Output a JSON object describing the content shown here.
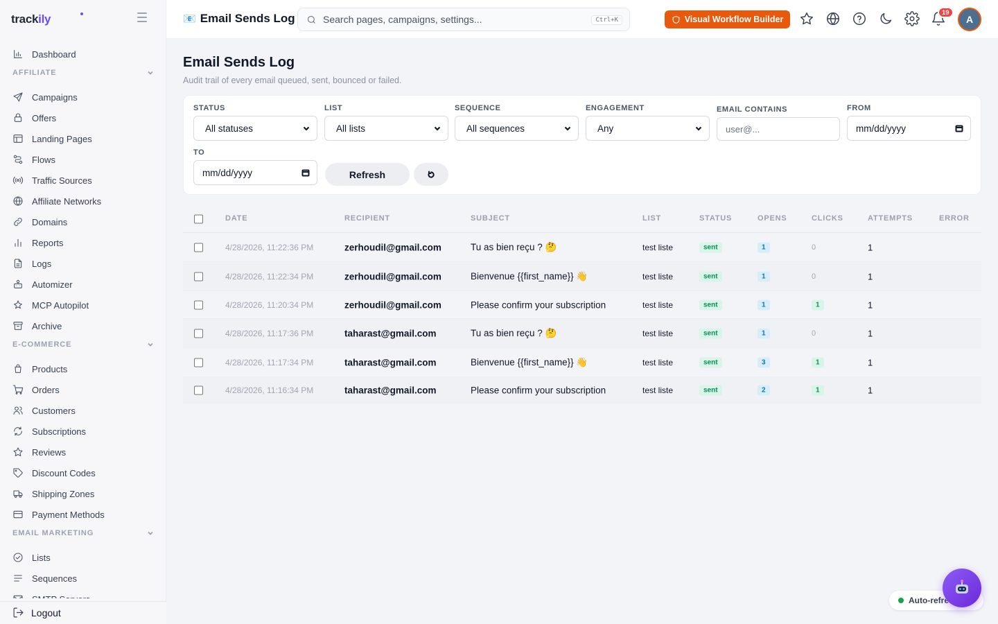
{
  "brand": {
    "name": "track",
    "accent": "ily"
  },
  "sidebar": {
    "items_top": [
      {
        "label": "Dashboard",
        "icon": "bar-chart-icon"
      }
    ],
    "sections": [
      {
        "title": "AFFILIATE",
        "items": [
          {
            "label": "Campaigns",
            "icon": "send-icon"
          },
          {
            "label": "Offers",
            "icon": "lock-icon"
          },
          {
            "label": "Landing Pages",
            "icon": "layout-icon"
          },
          {
            "label": "Flows",
            "icon": "route-icon"
          },
          {
            "label": "Traffic Sources",
            "icon": "radio-icon"
          },
          {
            "label": "Affiliate Networks",
            "icon": "globe-icon"
          },
          {
            "label": "Domains",
            "icon": "link-icon"
          },
          {
            "label": "Reports",
            "icon": "chart-icon"
          },
          {
            "label": "Logs",
            "icon": "file-icon"
          },
          {
            "label": "Automizer",
            "icon": "robot-icon"
          },
          {
            "label": "MCP Autopilot",
            "icon": "sparkle-icon"
          },
          {
            "label": "Archive",
            "icon": "archive-icon"
          }
        ]
      },
      {
        "title": "E-COMMERCE",
        "items": [
          {
            "label": "Products",
            "icon": "bag-icon"
          },
          {
            "label": "Orders",
            "icon": "cart-icon"
          },
          {
            "label": "Customers",
            "icon": "users-icon"
          },
          {
            "label": "Subscriptions",
            "icon": "refresh-icon"
          },
          {
            "label": "Reviews",
            "icon": "star-icon"
          },
          {
            "label": "Discount Codes",
            "icon": "tag-icon"
          },
          {
            "label": "Shipping Zones",
            "icon": "truck-icon"
          },
          {
            "label": "Payment Methods",
            "icon": "card-icon"
          }
        ]
      },
      {
        "title": "EMAIL MARKETING",
        "items": [
          {
            "label": "Lists",
            "icon": "check-circle-icon"
          },
          {
            "label": "Sequences",
            "icon": "lines-icon"
          },
          {
            "label": "SMTP Servers",
            "icon": "mail-icon"
          }
        ]
      }
    ],
    "logout": "Logout"
  },
  "topbar": {
    "page_emoji": "📧",
    "title": "Email Sends Log",
    "search_placeholder": "Search pages, campaigns, settings...",
    "search_shortcut": "Ctrl+K",
    "workflow_button": "Visual Workflow Builder",
    "notification_count": "19",
    "avatar_initial": "A",
    "colors": {
      "accent": "#e8590c",
      "brand": "#6d4cf0"
    }
  },
  "page": {
    "title": "Email Sends Log",
    "subtitle": "Audit trail of every email queued, sent, bounced or failed."
  },
  "filters": {
    "status": {
      "label": "STATUS",
      "value": "All statuses"
    },
    "list": {
      "label": "LIST",
      "value": "All lists"
    },
    "sequence": {
      "label": "SEQUENCE",
      "value": "All sequences"
    },
    "engagement": {
      "label": "ENGAGEMENT",
      "value": "Any"
    },
    "email": {
      "label": "EMAIL CONTAINS",
      "placeholder": "user@..."
    },
    "from": {
      "label": "FROM",
      "value": "mm/dd/yyyy"
    },
    "to": {
      "label": "TO",
      "value": "mm/dd/yyyy"
    },
    "refresh_label": "Refresh"
  },
  "table": {
    "columns": [
      "DATE",
      "RECIPIENT",
      "SUBJECT",
      "LIST",
      "STATUS",
      "OPENS",
      "CLICKS",
      "ATTEMPTS",
      "ERROR"
    ],
    "rows": [
      {
        "date": "4/28/2026, 11:22:36 PM",
        "recipient": "zerhoudil@gmail.com",
        "subject": "Tu as bien reçu ? 🤔",
        "list": "test liste",
        "status": "sent",
        "opens": "1",
        "clicks": "0",
        "attempts": "1",
        "error": ""
      },
      {
        "date": "4/28/2026, 11:22:34 PM",
        "recipient": "zerhoudil@gmail.com",
        "subject": "Bienvenue {{first_name}} 👋",
        "list": "test liste",
        "status": "sent",
        "opens": "1",
        "clicks": "0",
        "attempts": "1",
        "error": ""
      },
      {
        "date": "4/28/2026, 11:20:34 PM",
        "recipient": "zerhoudil@gmail.com",
        "subject": "Please confirm your subscription",
        "list": "test liste",
        "status": "sent",
        "opens": "1",
        "clicks": "1",
        "attempts": "1",
        "error": ""
      },
      {
        "date": "4/28/2026, 11:17:36 PM",
        "recipient": "taharast@gmail.com",
        "subject": "Tu as bien reçu ? 🤔",
        "list": "test liste",
        "status": "sent",
        "opens": "1",
        "clicks": "0",
        "attempts": "1",
        "error": ""
      },
      {
        "date": "4/28/2026, 11:17:34 PM",
        "recipient": "taharast@gmail.com",
        "subject": "Bienvenue {{first_name}} 👋",
        "list": "test liste",
        "status": "sent",
        "opens": "3",
        "clicks": "1",
        "attempts": "1",
        "error": ""
      },
      {
        "date": "4/28/2026, 11:16:34 PM",
        "recipient": "taharast@gmail.com",
        "subject": "Please confirm your subscription",
        "list": "test liste",
        "status": "sent",
        "opens": "2",
        "clicks": "1",
        "attempts": "1",
        "error": ""
      }
    ]
  },
  "floating": {
    "auto_refresh": "Auto-refresh"
  }
}
